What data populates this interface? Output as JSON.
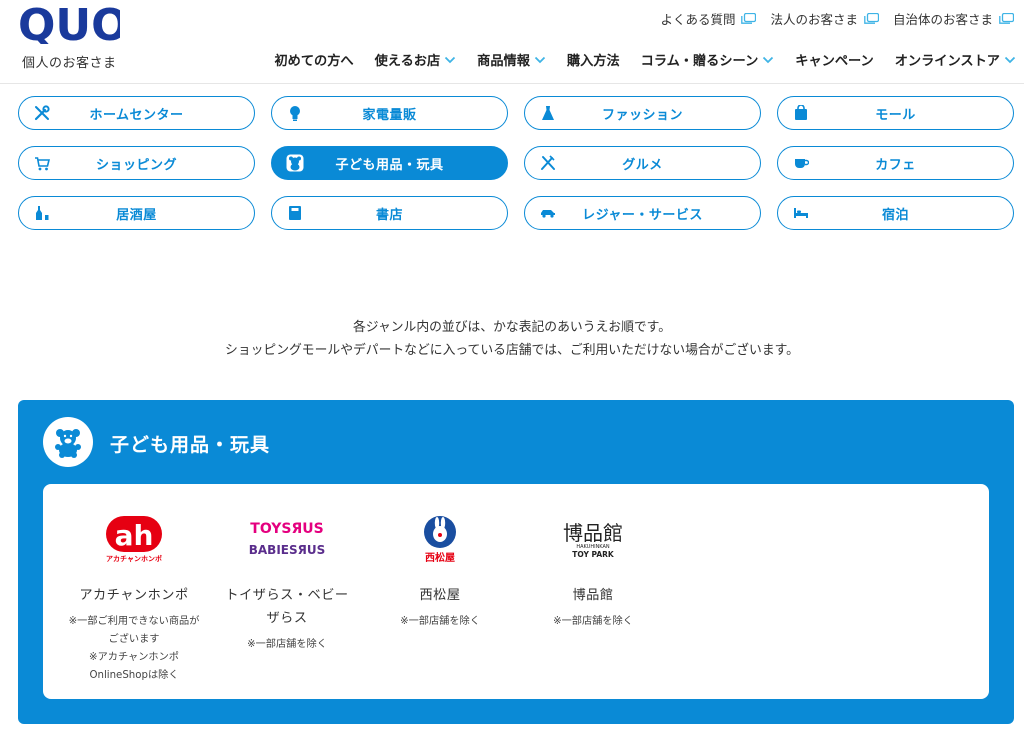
{
  "brand": {
    "logo_text": "QUO",
    "subtitle": "個人のお客さま"
  },
  "utility_nav": [
    {
      "label": "よくある質問"
    },
    {
      "label": "法人のお客さま"
    },
    {
      "label": "自治体のお客さま"
    }
  ],
  "global_nav": [
    {
      "label": "初めての方へ",
      "has_dropdown": false
    },
    {
      "label": "使えるお店",
      "has_dropdown": true
    },
    {
      "label": "商品情報",
      "has_dropdown": true
    },
    {
      "label": "購入方法",
      "has_dropdown": false
    },
    {
      "label": "コラム・贈るシーン",
      "has_dropdown": true
    },
    {
      "label": "キャンペーン",
      "has_dropdown": false
    },
    {
      "label": "オンラインストア",
      "has_dropdown": true
    }
  ],
  "categories": [
    {
      "label": "ホームセンター",
      "icon": "tools-icon",
      "active": false
    },
    {
      "label": "家電量販",
      "icon": "lightbulb-icon",
      "active": false
    },
    {
      "label": "ファッション",
      "icon": "dress-icon",
      "active": false
    },
    {
      "label": "モール",
      "icon": "shopping-bag-icon",
      "active": false
    },
    {
      "label": "ショッピング",
      "icon": "cart-icon",
      "active": false
    },
    {
      "label": "子ども用品・玩具",
      "icon": "teddy-bear-icon",
      "active": true
    },
    {
      "label": "グルメ",
      "icon": "cutlery-icon",
      "active": false
    },
    {
      "label": "カフェ",
      "icon": "coffee-cup-icon",
      "active": false
    },
    {
      "label": "居酒屋",
      "icon": "sake-bottle-icon",
      "active": false
    },
    {
      "label": "書店",
      "icon": "book-icon",
      "active": false
    },
    {
      "label": "レジャー・サービス",
      "icon": "car-icon",
      "active": false
    },
    {
      "label": "宿泊",
      "icon": "bed-icon",
      "active": false
    }
  ],
  "notes": {
    "line1": "各ジャンル内の並びは、かな表記のあいうえお順です。",
    "line2": "ショッピングモールやデパートなどに入っている店舗では、ご利用いただけない場合がございます。"
  },
  "section": {
    "title": "子ども用品・玩具",
    "icon": "teddy-bear-icon",
    "stores": [
      {
        "name": "アカチャンホンポ",
        "logo_text": "ah",
        "logo_sub": "アカチャンホンポ",
        "notes": [
          "※一部ご利用できない商品が",
          "ございます",
          "※アカチャンホンポ",
          "OnlineShopは除く"
        ]
      },
      {
        "name_line1": "トイザらス・ベビー",
        "name_line2": "ザらス",
        "logo_line1": "TOYSЯUS",
        "logo_line2": "BABIESЯUS",
        "notes": [
          "※一部店舗を除く"
        ]
      },
      {
        "name": "西松屋",
        "logo_text": "西松屋",
        "notes": [
          "※一部店舗を除く"
        ]
      },
      {
        "name": "博品館",
        "logo_text": "博品館",
        "logo_sub1": "HAKUHINKAN",
        "logo_sub2": "TOY PARK",
        "notes": [
          "※一部店舗を除く"
        ]
      }
    ]
  },
  "colors": {
    "brand_blue": "#0a8ad6",
    "logo_navy": "#1a3a9c",
    "icon_cyan": "#3fb4e6"
  }
}
